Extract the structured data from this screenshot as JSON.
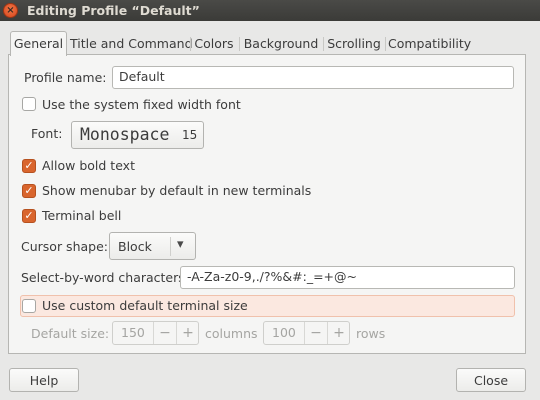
{
  "window": {
    "title": "Editing Profile “Default”",
    "close_glyph": "×"
  },
  "tabs": [
    {
      "label": "General",
      "active": true
    },
    {
      "label": "Title and Command"
    },
    {
      "label": "Colors"
    },
    {
      "label": "Background"
    },
    {
      "label": "Scrolling"
    },
    {
      "label": "Compatibility"
    }
  ],
  "general": {
    "profile_name_label": "Profile name:",
    "profile_name_value": "Default",
    "use_system_font_label": "Use the system fixed width font",
    "use_system_font_checked": false,
    "font_label": "Font:",
    "font_name": "Monospace",
    "font_size": "15",
    "allow_bold_label": "Allow bold text",
    "allow_bold_checked": true,
    "show_menubar_label": "Show menubar by default in new terminals",
    "show_menubar_checked": true,
    "terminal_bell_label": "Terminal bell",
    "terminal_bell_checked": true,
    "cursor_shape_label": "Cursor shape:",
    "cursor_shape_value": "Block",
    "select_chars_label": "Select-by-word characters:",
    "select_chars_value": "-A-Za-z0-9,./?%&#:_=+@~",
    "custom_size_label": "Use custom default terminal size",
    "custom_size_checked": false,
    "default_size_label": "Default size:",
    "columns_value": "150",
    "columns_label": "columns",
    "rows_value": "100",
    "rows_label": "rows",
    "minus_glyph": "−",
    "plus_glyph": "+",
    "check_glyph": "✓",
    "dropdown_glyph": "▾"
  },
  "footer": {
    "help_label": "Help",
    "close_label": "Close"
  },
  "colors": {
    "accent": "#d9652d",
    "titlebar": "#3c3b37",
    "highlight": "#fbe8e0"
  }
}
